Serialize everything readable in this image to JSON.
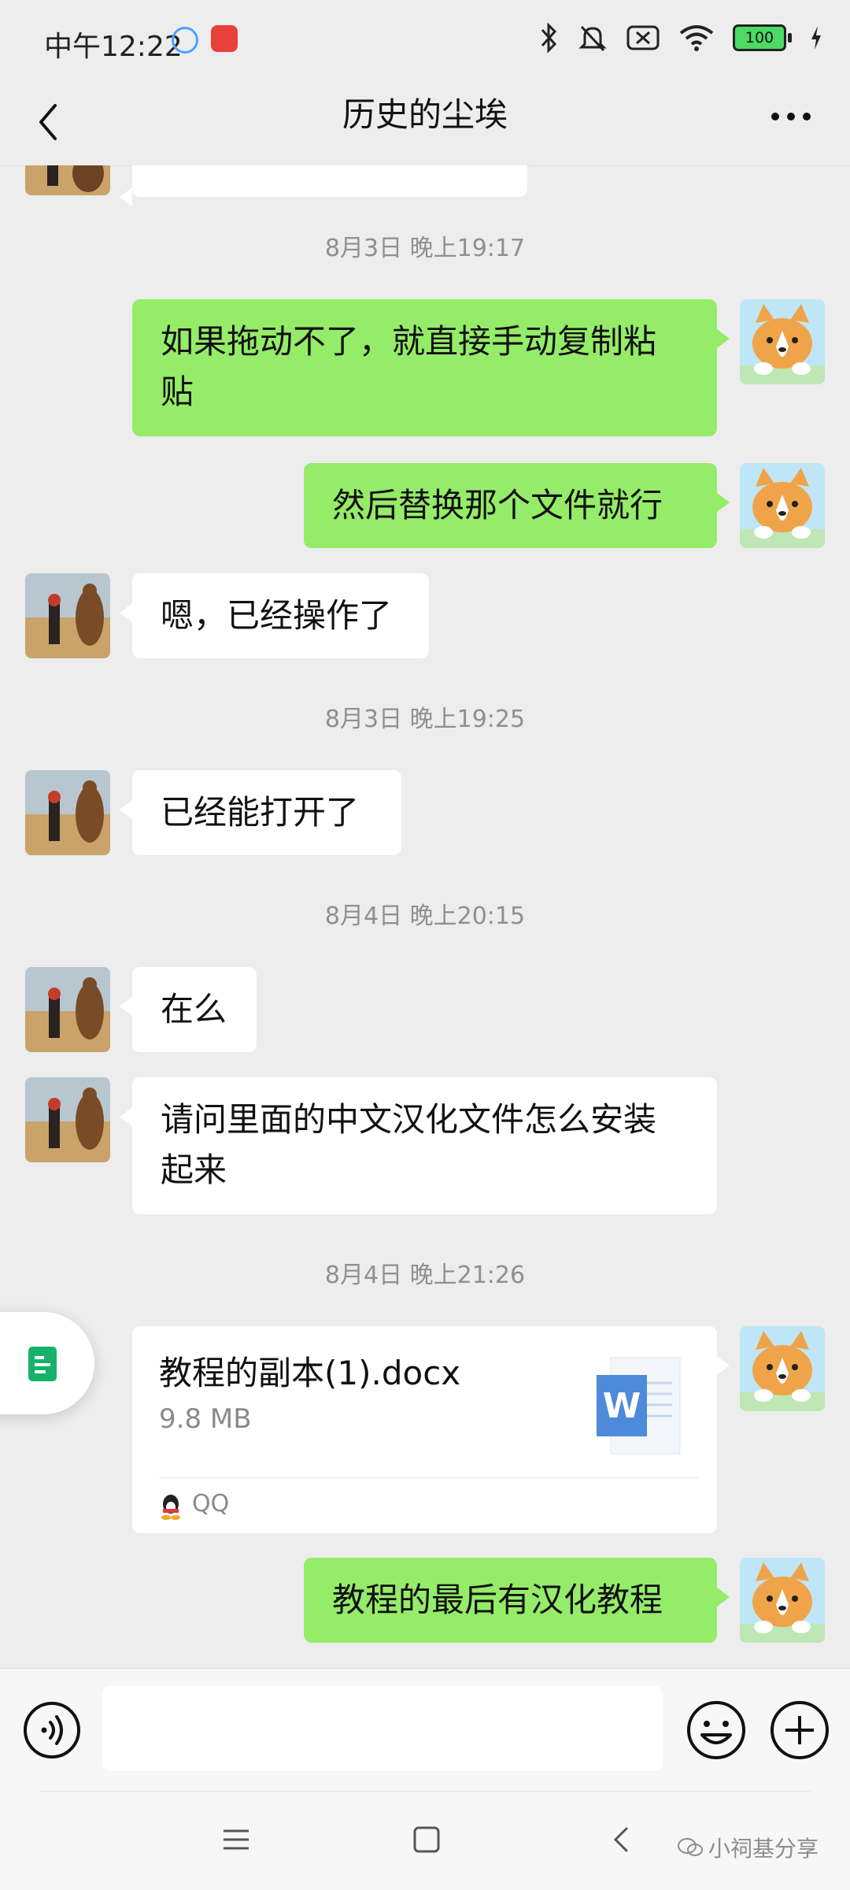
{
  "status_bar": {
    "time": "中午12:22",
    "battery": "100"
  },
  "header": {
    "title": "历史的尘埃"
  },
  "messages": [
    {
      "type": "timestamp",
      "text": "8月3日 晚上19:17"
    },
    {
      "type": "out",
      "line1": "如果拖动不了，就直接手动复制粘",
      "line2": "贴"
    },
    {
      "type": "out",
      "text": "然后替换那个文件就行"
    },
    {
      "type": "in",
      "text": "嗯，已经操作了"
    },
    {
      "type": "timestamp",
      "text": "8月3日 晚上19:25"
    },
    {
      "type": "in",
      "text": "已经能打开了"
    },
    {
      "type": "timestamp",
      "text": "8月4日 晚上20:15"
    },
    {
      "type": "in",
      "text": "在么"
    },
    {
      "type": "in",
      "line1": "请问里面的中文汉化文件怎么安装",
      "line2": "起来"
    },
    {
      "type": "timestamp",
      "text": "8月4日 晚上21:26"
    },
    {
      "type": "file",
      "name": "教程的副本(1).docx",
      "size": "9.8 MB",
      "source": "QQ",
      "icon_letter": "W"
    },
    {
      "type": "out",
      "text": "教程的最后有汉化教程"
    }
  ],
  "input": {
    "value": "",
    "placeholder": ""
  },
  "watermark": {
    "text": "小祠基分享"
  },
  "colors": {
    "background": "#ededed",
    "outgoing_bubble": "#95ec69",
    "incoming_bubble": "#ffffff",
    "timestamp": "#8f8f8f"
  },
  "icons": [
    "back-icon",
    "more-icon",
    "voice-icon",
    "emoji-icon",
    "plus-icon",
    "word-file-icon",
    "qq-icon",
    "nav-menu-icon",
    "nav-home-icon",
    "nav-back-icon"
  ]
}
